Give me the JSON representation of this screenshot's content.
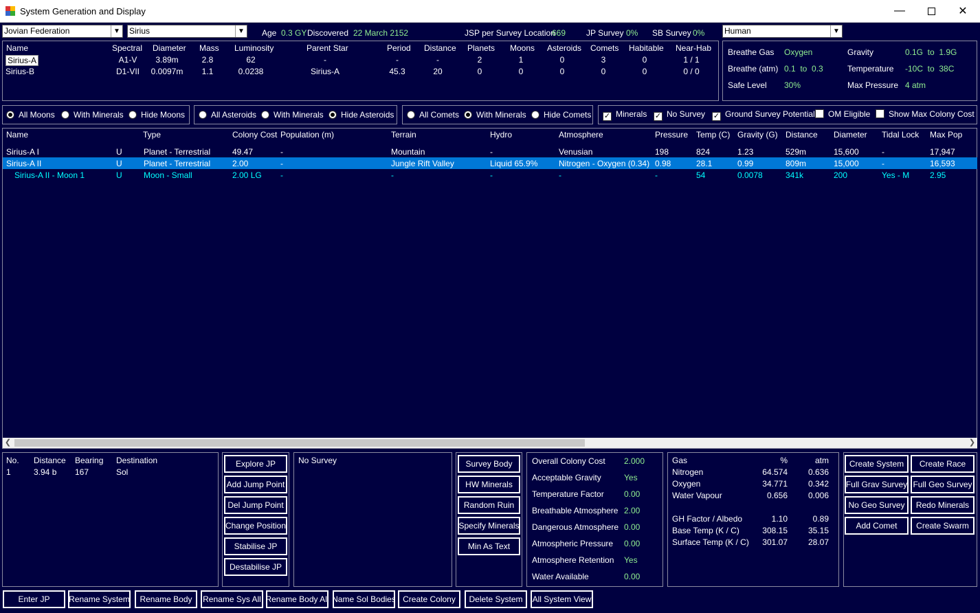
{
  "window": {
    "title": "System Generation and Display"
  },
  "top": {
    "empire": "Jovian Federation",
    "system": "Sirius",
    "age_label": "Age",
    "age_value": "0.3 GY",
    "discovered_label": "Discovered",
    "discovered_value": "22 March 2152",
    "jsp_label": "JSP per Survey Location",
    "jsp_value": "669",
    "jp_survey_label": "JP Survey",
    "jp_survey_value": "0%",
    "sb_survey_label": "SB Survey",
    "sb_survey_value": "0%",
    "race": "Human"
  },
  "stars": {
    "headers": [
      "Name",
      "Spectral",
      "Diameter",
      "Mass",
      "Luminosity",
      "Parent Star",
      "Period",
      "Distance",
      "Planets",
      "Moons",
      "Asteroids",
      "Comets",
      "Habitable",
      "Near-Hab"
    ],
    "rows": [
      [
        "Sirius-A",
        "A1-V",
        "3.89m",
        "2.8",
        "62",
        "-",
        "-",
        "-",
        "2",
        "1",
        "0",
        "3",
        "0",
        "1 / 1"
      ],
      [
        "Sirius-B",
        "D1-VII",
        "0.0097m",
        "1.1",
        "0.0238",
        "Sirius-A",
        "45.3",
        "20",
        "0",
        "0",
        "0",
        "0",
        "0",
        "0 / 0"
      ]
    ]
  },
  "race_env": {
    "breathe_gas_label": "Breathe Gas",
    "breathe_gas": "Oxygen",
    "gravity_label": "Gravity",
    "gravity": "0.1G  to  1.9G",
    "breathe_atm_label": "Breathe (atm)",
    "breathe_atm": "0.1  to  0.3",
    "temperature_label": "Temperature",
    "temperature": "-10C  to  38C",
    "safe_level_label": "Safe Level",
    "safe_level": "30%",
    "max_pressure_label": "Max Pressure",
    "max_pressure": "4 atm"
  },
  "filters": {
    "moons": [
      "All Moons",
      "With Minerals",
      "Hide Moons"
    ],
    "asteroids": [
      "All Asteroids",
      "With Minerals",
      "Hide Asteroids"
    ],
    "comets": [
      "All Comets",
      "With Minerals",
      "Hide Comets"
    ],
    "checks": [
      "Minerals",
      "No Survey",
      "Ground Survey Potential",
      "OM Eligible",
      "Show Max Colony Cost"
    ]
  },
  "bodies": {
    "headers": [
      "Name",
      "Type",
      "Colony Cost",
      "Population (m)",
      "Terrain",
      "Hydro",
      "Atmosphere",
      "Pressure",
      "Temp (C)",
      "Gravity (G)",
      "Distance",
      "Diameter",
      "Tidal Lock",
      "Max Pop"
    ],
    "rows": [
      {
        "name": "Sirius-A I",
        "flag": "U",
        "type": "Planet - Terrestrial",
        "cc": "49.47",
        "pop": "-",
        "terrain": "Mountain",
        "hydro": "-",
        "atm": "Venusian",
        "pressure": "198",
        "temp": "824",
        "grav": "1.23",
        "dist": "529m",
        "diam": "15,600",
        "tidal": "-",
        "maxpop": "17,947"
      },
      {
        "name": "Sirius-A II",
        "flag": "U",
        "type": "Planet - Terrestrial",
        "cc": "2.00",
        "pop": "-",
        "terrain": "Jungle Rift Valley",
        "hydro": "Liquid 65.9%",
        "atm": "Nitrogen - Oxygen (0.34)",
        "pressure": "0.98",
        "temp": "28.1",
        "grav": "0.99",
        "dist": "809m",
        "diam": "15,000",
        "tidal": "-",
        "maxpop": "16,593"
      },
      {
        "name": "Sirius-A II - Moon 1",
        "flag": "U",
        "type": "Moon - Small",
        "cc": "2.00 LG",
        "pop": "-",
        "terrain": "-",
        "hydro": "-",
        "atm": "-",
        "pressure": "-",
        "temp": "54",
        "grav": "0.0078",
        "dist": "341k",
        "diam": "200",
        "tidal": "Yes - M",
        "maxpop": "2.95"
      }
    ]
  },
  "jump_points": {
    "headers": [
      "No.",
      "Distance",
      "Bearing",
      "Destination"
    ],
    "rows": [
      [
        "1",
        "3.94 b",
        "167",
        "Sol"
      ]
    ]
  },
  "jp_buttons": [
    "Explore JP",
    "Add Jump Point",
    "Del Jump Point",
    "Change Position",
    "Stabilise JP",
    "Destabilise JP"
  ],
  "survey_text": "No Survey",
  "survey_buttons": [
    "Survey Body",
    "HW Minerals",
    "Random Ruin",
    "Specify Minerals",
    "Min As Text"
  ],
  "colony_cost": [
    [
      "Overall Colony Cost",
      "2.000"
    ],
    [
      "Acceptable Gravity",
      "Yes"
    ],
    [
      "Temperature Factor",
      "0.00"
    ],
    [
      "Breathable Atmosphere",
      "2.00"
    ],
    [
      "Dangerous Atmosphere",
      "0.00"
    ],
    [
      "Atmospheric Pressure",
      "0.00"
    ],
    [
      "Atmosphere Retention",
      "Yes"
    ],
    [
      "Water Available",
      "0.00"
    ]
  ],
  "atmosphere": {
    "headers": [
      "Gas",
      "%",
      "atm"
    ],
    "rows": [
      [
        "Nitrogen",
        "64.574",
        "0.636"
      ],
      [
        "Oxygen",
        "34.771",
        "0.342"
      ],
      [
        "Water Vapour",
        "0.656",
        "0.006"
      ]
    ],
    "extra": [
      [
        "GH Factor / Albedo",
        "1.10",
        "0.89"
      ],
      [
        "Base Temp (K / C)",
        "308.15",
        "35.15"
      ],
      [
        "Surface Temp (K / C)",
        "301.07",
        "28.07"
      ]
    ]
  },
  "right_buttons": [
    "Create System",
    "Create Race",
    "Full Grav Survey",
    "Full Geo Survey",
    "No Geo Survey",
    "Redo Minerals",
    "Add Comet",
    "Create Swarm"
  ],
  "bottom_buttons": [
    "Enter JP",
    "Rename System",
    "Rename Body",
    "Rename Sys All",
    "Rename Body All",
    "Name Sol Bodies",
    "Create Colony",
    "Delete System",
    "All System View"
  ]
}
